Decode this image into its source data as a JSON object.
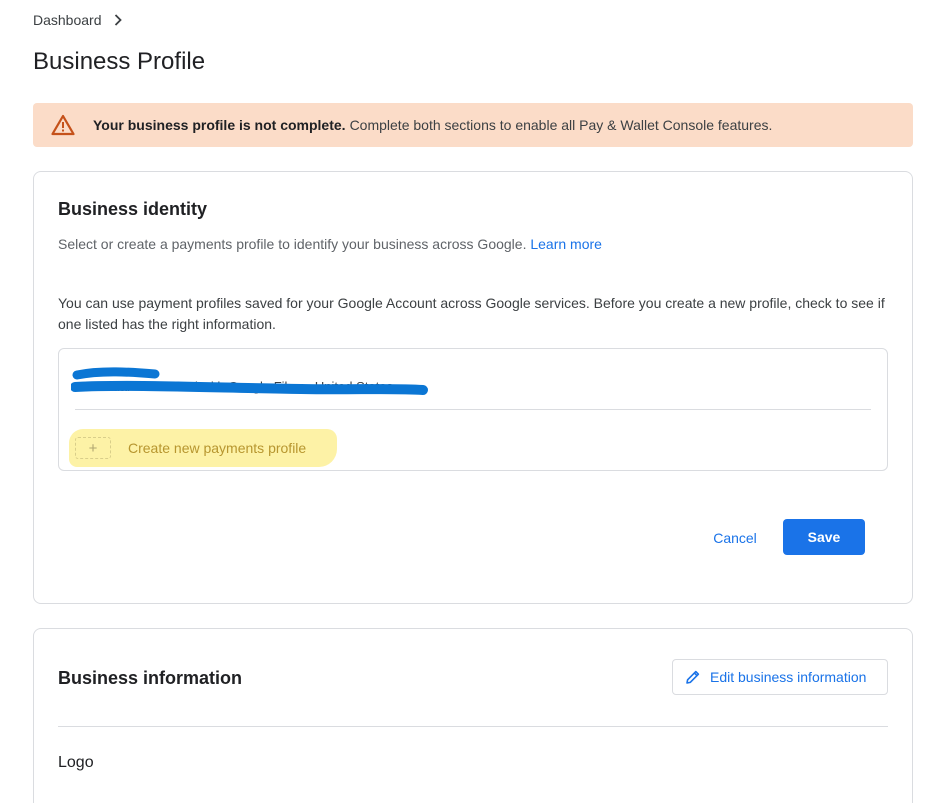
{
  "breadcrumb": {
    "dashboard": "Dashboard"
  },
  "page": {
    "title": "Business Profile"
  },
  "banner": {
    "bold": "Your business profile is not complete.",
    "text": "Complete both sections to enable all Pay & Wallet Console features."
  },
  "identity": {
    "title": "Business identity",
    "subtitle": "Select or create a payments profile to identify your business across Google.",
    "learn_more": "Learn more",
    "description": "You can use payment profiles saved for your Google Account across Google services. Before you create a new profile, check to see if one listed has the right information.",
    "profile_detail": "Individual · Also used with Google Fiber · United States",
    "create_label": "Create new payments profile",
    "plus": "+",
    "cancel": "Cancel",
    "save": "Save"
  },
  "info": {
    "title": "Business information",
    "edit": "Edit business information",
    "logo": "Logo"
  },
  "colors": {
    "accent": "#1a73e8",
    "warning_bg": "#fbdcc8",
    "warning_icon": "#c5511a",
    "highlight": "#fdf2a6",
    "scribble": "#0b76d4"
  }
}
